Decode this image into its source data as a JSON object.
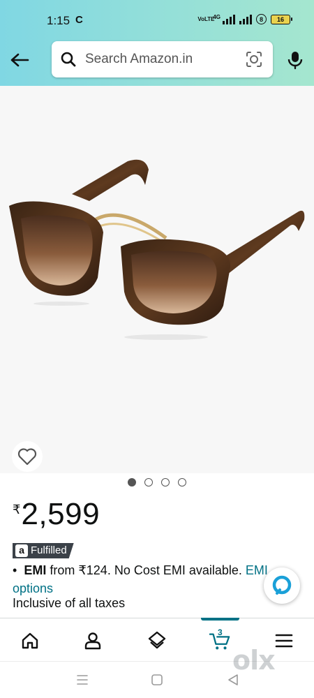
{
  "status_bar": {
    "time": "1:15",
    "cloud_icon": "C",
    "volte_text": "VoLTE",
    "network_type": "4G",
    "circle_badge": "8",
    "battery_level": "16"
  },
  "search": {
    "placeholder": "Search Amazon.in"
  },
  "gallery": {
    "image_count": 4,
    "active_index": 0
  },
  "product": {
    "currency_symbol": "₹",
    "price": "2,599",
    "fulfilled_logo": "a",
    "fulfilled_label": "Fulfilled",
    "emi_bold": "EMI",
    "emi_text": " from ₹124. No Cost EMI available. ",
    "emi_link": "EMI options",
    "taxes_text": "Inclusive of all taxes"
  },
  "bottom_nav": {
    "cart_count": "3"
  },
  "watermark": {
    "text": "olx"
  },
  "colors": {
    "header_gradient_start": "#80d7e3",
    "header_gradient_end": "#a5e6cf",
    "link": "#007185",
    "fulfilled_bg": "#3b4148"
  }
}
